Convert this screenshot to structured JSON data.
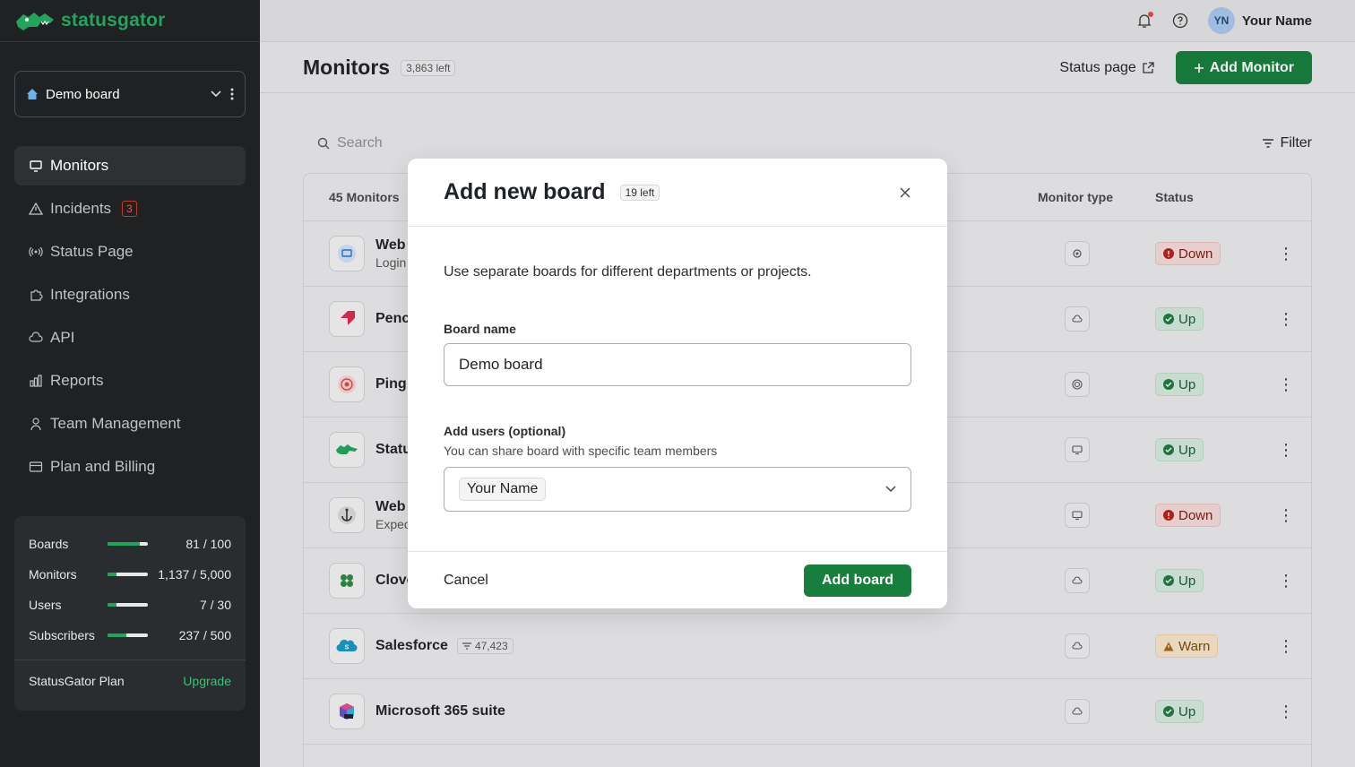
{
  "app": {
    "logo_text": "statusgator"
  },
  "sidebar": {
    "board": "Demo board",
    "items": [
      {
        "label": "Monitors",
        "icon": "monitor-icon",
        "active": true
      },
      {
        "label": "Incidents",
        "icon": "warning-icon",
        "badge": "3"
      },
      {
        "label": "Status Page",
        "icon": "broadcast-icon"
      },
      {
        "label": "Integrations",
        "icon": "puzzle-icon"
      },
      {
        "label": "API",
        "icon": "cloud-icon"
      },
      {
        "label": "Reports",
        "icon": "bar-chart-icon"
      },
      {
        "label": "Team Management",
        "icon": "user-icon"
      },
      {
        "label": "Plan and Billing",
        "icon": "card-icon"
      }
    ],
    "usage": [
      {
        "name": "Boards",
        "value": "81 / 100",
        "fraction": 0.81
      },
      {
        "name": "Monitors",
        "value": "1,137 / 5,000",
        "fraction": 0.23
      },
      {
        "name": "Users",
        "value": "7 / 30",
        "fraction": 0.23
      },
      {
        "name": "Subscribers",
        "value": "237 / 500",
        "fraction": 0.47
      }
    ],
    "plan": "StatusGator Plan",
    "upgrade": "Upgrade"
  },
  "topbar": {
    "avatar": "YN",
    "user": "Your Name"
  },
  "header": {
    "title": "Monitors",
    "left": "3,863 left",
    "status_page": "Status page",
    "add_monitor": "Add Monitor"
  },
  "content": {
    "search_placeholder": "Search",
    "filter": "Filter",
    "table": {
      "count_header": "45 Monitors",
      "type_header": "Monitor type",
      "status_header": "Status",
      "rows": [
        {
          "name": "Web",
          "sub": "Login",
          "status": "Down",
          "kind": "down"
        },
        {
          "name": "Penc",
          "sub": "",
          "status": "Up",
          "kind": "up"
        },
        {
          "name": "Ping",
          "sub": "",
          "status": "Up",
          "kind": "up"
        },
        {
          "name": "Statu",
          "sub": "",
          "status": "Up",
          "kind": "up"
        },
        {
          "name": "Web",
          "sub": "Expec",
          "status": "Down",
          "kind": "down"
        },
        {
          "name": "Clove",
          "sub": "",
          "status": "Up",
          "kind": "up"
        },
        {
          "name": "Salesforce",
          "sub": "",
          "count": "47,423",
          "status": "Warn",
          "kind": "warn"
        },
        {
          "name": "Microsoft 365 suite",
          "sub": "",
          "status": "Up",
          "kind": "up"
        }
      ]
    }
  },
  "modal": {
    "title": "Add new board",
    "badge": "19 left",
    "description": "Use separate boards for different departments or projects.",
    "board_name_label": "Board name",
    "board_name_value": "Demo board",
    "users_label": "Add users (optional)",
    "users_help": "You can share board with specific team members",
    "selected_user": "Your Name",
    "cancel": "Cancel",
    "submit": "Add board"
  }
}
